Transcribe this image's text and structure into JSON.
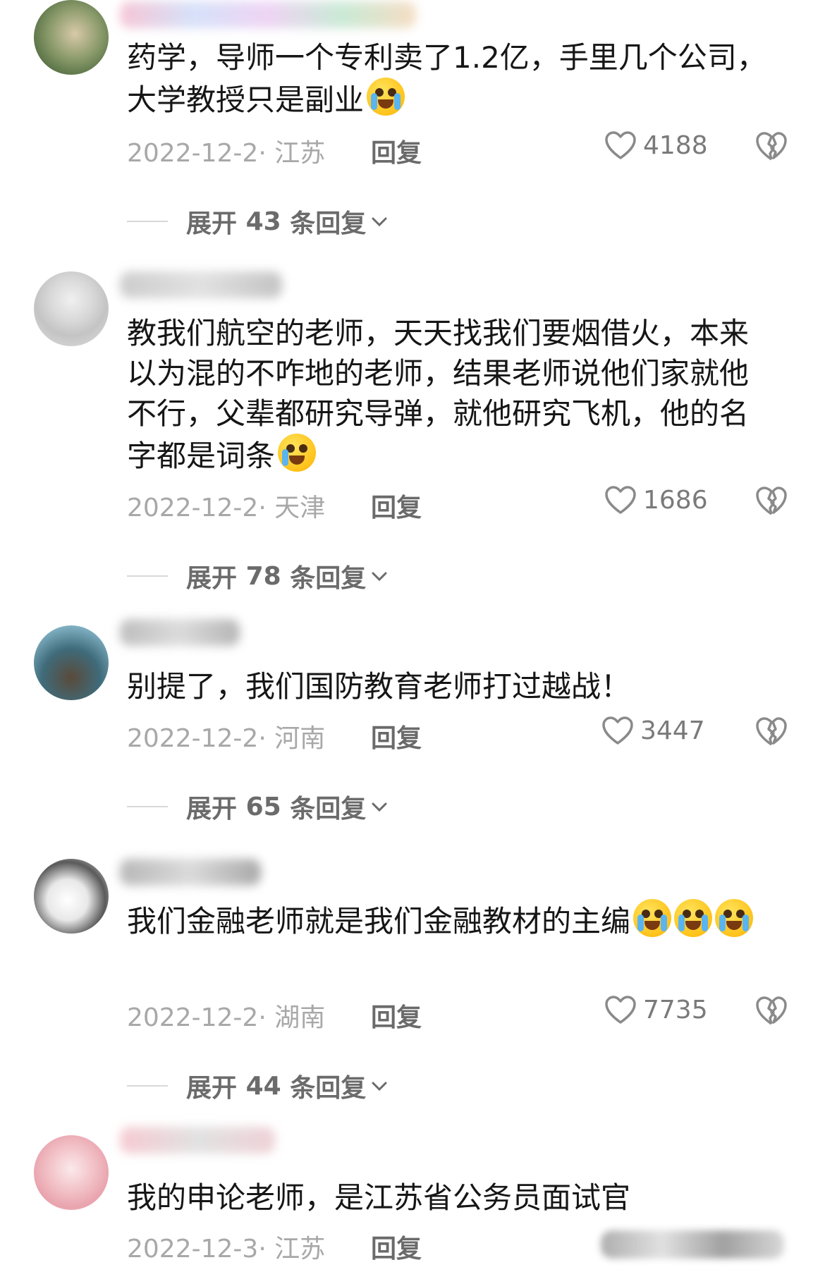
{
  "comments": [
    {
      "text": "药学，导师一个专利卖了1.2亿，手里几个公司，大学教授只是副业",
      "date": "2022-12-2",
      "location": "江苏",
      "reply_label": "回复",
      "likes": "4188",
      "expand": {
        "prefix": "展开",
        "count": "43",
        "suffix": "条回复"
      }
    },
    {
      "text": "教我们航空的老师，天天找我们要烟借火，本来以为混的不咋地的老师，结果老师说他们家就他不行，父辈都研究导弹，就他研究飞机，他的名字都是词条",
      "date": "2022-12-2",
      "location": "天津",
      "reply_label": "回复",
      "likes": "1686",
      "expand": {
        "prefix": "展开",
        "count": "78",
        "suffix": "条回复"
      }
    },
    {
      "text": "别提了，我们国防教育老师打过越战！",
      "date": "2022-12-2",
      "location": "河南",
      "reply_label": "回复",
      "likes": "3447",
      "expand": {
        "prefix": "展开",
        "count": "65",
        "suffix": "条回复"
      }
    },
    {
      "text": "我们金融老师就是我们金融教材的主编",
      "date": "2022-12-2",
      "location": "湖南",
      "reply_label": "回复",
      "likes": "7735",
      "expand": {
        "prefix": "展开",
        "count": "44",
        "suffix": "条回复"
      }
    },
    {
      "text": "我的申论老师，是江苏省公务员面试官",
      "date": "2022-12-3",
      "location": "江苏",
      "reply_label": "回复"
    }
  ],
  "icons": {
    "like": "heart-outline-icon",
    "dislike": "broken-heart-icon",
    "expand": "chevron-down-icon"
  },
  "colors": {
    "text": "#161616",
    "meta": "#a8a8a8",
    "secondary": "#6b6b6b"
  }
}
